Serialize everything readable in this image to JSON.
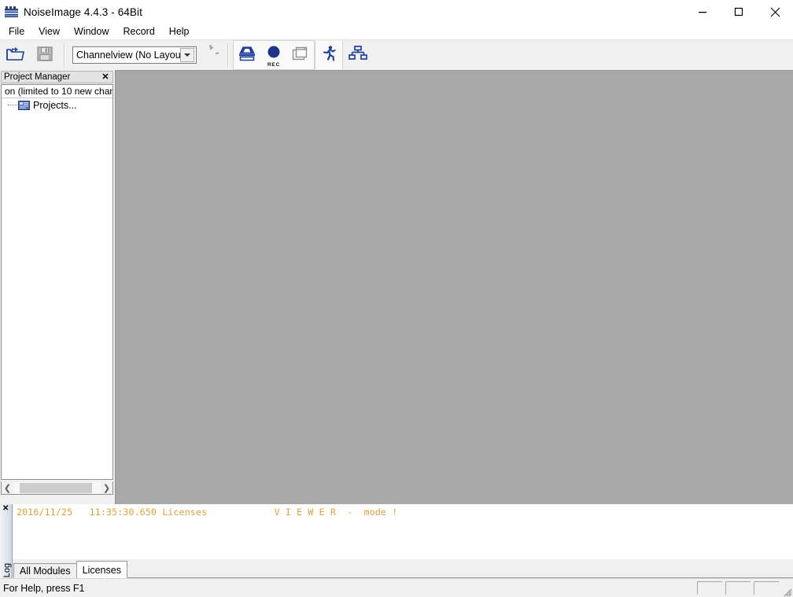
{
  "window": {
    "title": "NoiseImage 4.4.3 - 64Bit",
    "app_icon": "noiseimage-logo-icon",
    "controls": {
      "minimize": "minimize-icon",
      "maximize": "maximize-icon",
      "close": "close-icon"
    }
  },
  "menubar": {
    "items": [
      {
        "label": "File"
      },
      {
        "label": "View"
      },
      {
        "label": "Window"
      },
      {
        "label": "Record"
      },
      {
        "label": "Help"
      }
    ]
  },
  "toolbar": {
    "open_icon": "open-folder-icon",
    "save_icon": "floppy-save-icon",
    "layout_combo": {
      "value": "Channelview (No Layout)",
      "arrow_icon": "chevron-down-icon"
    },
    "refresh_icon": "refresh-circular-arrow-icon",
    "measure_icon": "measurement-device-icon",
    "record_icon": "record-circle-icon",
    "record_label": "REC",
    "new_window_icon": "new-document-window-icon",
    "run_icon": "running-man-icon",
    "network_icon": "network-hierarchy-icon"
  },
  "project_manager": {
    "caption": "Project Manager",
    "close_icon": "close-icon",
    "license_row": "on   (limited to 10 new chan",
    "tree": [
      {
        "label": "Projects...",
        "icon": "projects-folder-icon"
      }
    ],
    "hscroll": {
      "left_arrow": "chevron-left-icon",
      "right_arrow": "chevron-right-icon"
    }
  },
  "log_panel": {
    "side_label": "Log",
    "side_close_icon": "close-icon",
    "entries": [
      {
        "date": "2016/11/25",
        "time": "11:35:30.650",
        "module": "Licenses",
        "message": "V I E W E R  -  mode !"
      }
    ],
    "tabs": [
      {
        "label": "All Modules",
        "active": false
      },
      {
        "label": "Licenses",
        "active": true
      }
    ]
  },
  "statusbar": {
    "hint": "For Help, press F1",
    "panes": [
      "",
      "",
      ""
    ],
    "resize_grip_icon": "resize-grip-icon"
  },
  "colors": {
    "client_area": "#a8a8a8",
    "chrome": "#f0f0f0",
    "accent_blue": "#1f3f8f",
    "log_text": "#e3a03a"
  }
}
